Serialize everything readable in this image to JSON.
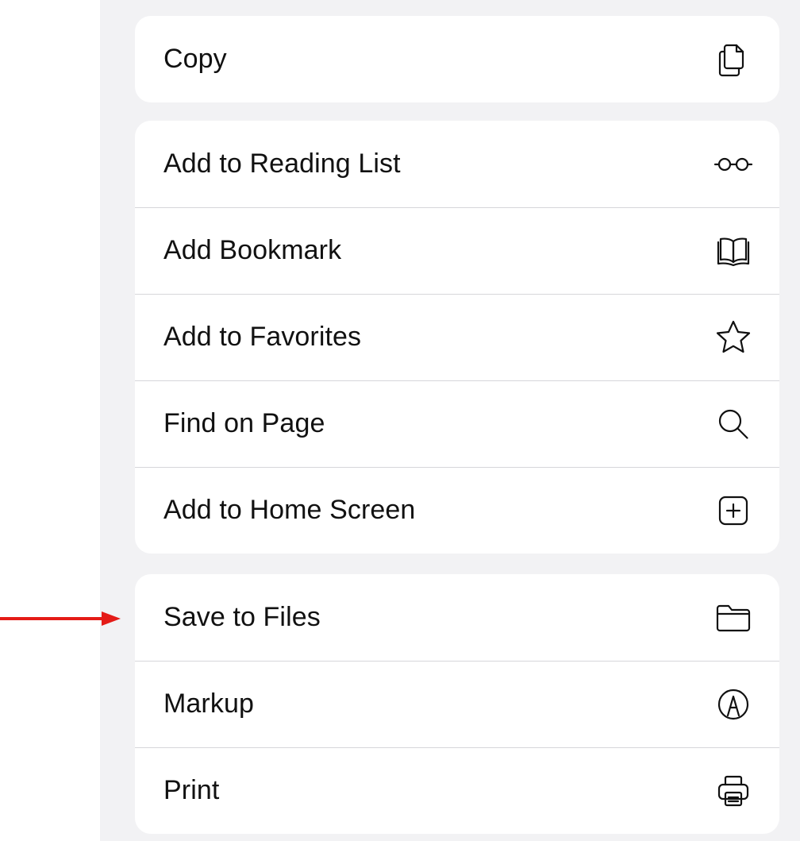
{
  "groups": [
    {
      "items": [
        {
          "label": "Copy",
          "icon": "copy-icon"
        }
      ]
    },
    {
      "items": [
        {
          "label": "Add to Reading List",
          "icon": "glasses-icon"
        },
        {
          "label": "Add Bookmark",
          "icon": "book-icon"
        },
        {
          "label": "Add to Favorites",
          "icon": "star-icon"
        },
        {
          "label": "Find on Page",
          "icon": "search-icon"
        },
        {
          "label": "Add to Home Screen",
          "icon": "plus-square-icon"
        }
      ]
    },
    {
      "items": [
        {
          "label": "Save to Files",
          "icon": "folder-icon"
        },
        {
          "label": "Markup",
          "icon": "markup-pen-icon"
        },
        {
          "label": "Print",
          "icon": "printer-icon"
        }
      ]
    }
  ],
  "annotation": {
    "type": "arrow",
    "color": "#e41b17",
    "points_to": "Save to Files"
  }
}
